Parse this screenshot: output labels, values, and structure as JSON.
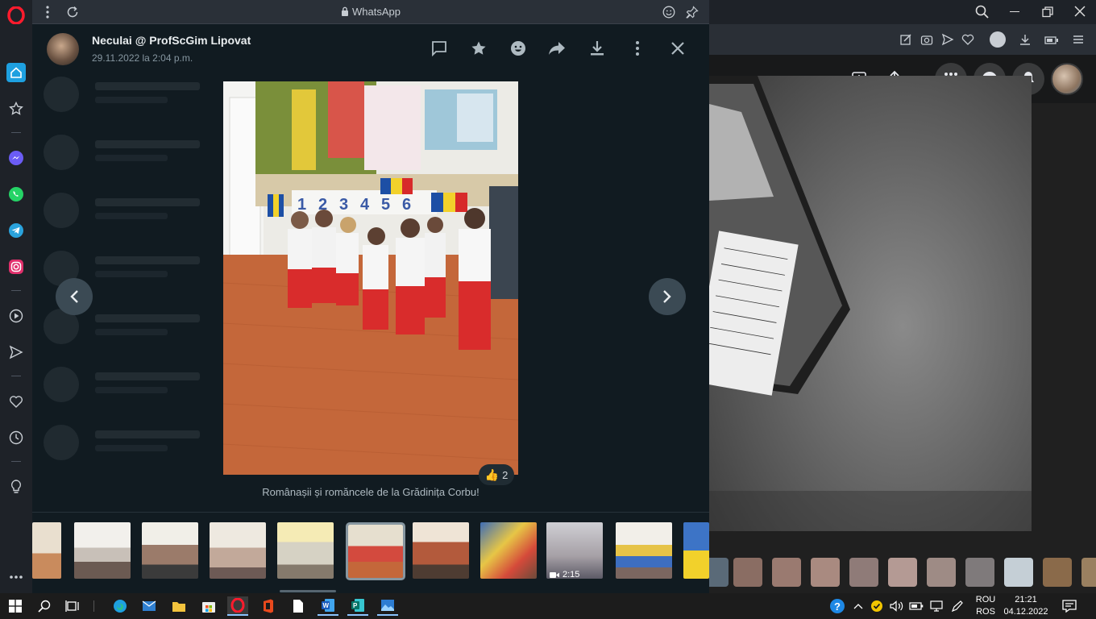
{
  "whatsapp": {
    "window_title": "WhatsApp",
    "sender_name": "Neculai @ ProfScGim Lipovat",
    "timestamp": "29.11.2022 la 2:04 p.m.",
    "caption": "Românașii și romăncele de la Grădinița Corbu!",
    "reaction": {
      "emoji": "👍",
      "count": "2"
    },
    "video_duration": "2:15",
    "header_actions": [
      "message-icon",
      "star-icon",
      "emoji-icon",
      "forward-icon",
      "download-icon",
      "more-icon",
      "close-icon"
    ]
  },
  "taskbar": {
    "lang_top": "ROU",
    "lang_bottom": "ROS",
    "time": "21:21",
    "date": "04.12.2022"
  },
  "colors": {
    "wa_bg": "#111b21",
    "opera_red": "#ff1b2d",
    "accent": "#1ea0e0"
  }
}
